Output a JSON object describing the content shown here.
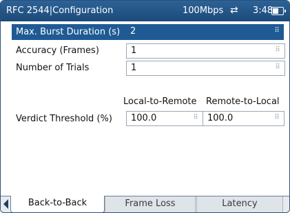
{
  "status_bar": {
    "title": "RFC 2544|Configuration",
    "speed": "100Mbps",
    "swap_icon": "link-swap-icon",
    "time": "3:48",
    "battery_icon": "battery-icon"
  },
  "fields": [
    {
      "label": "Max. Burst Duration (s)",
      "value": "2"
    },
    {
      "label": "Accuracy (Frames)",
      "value": "1"
    },
    {
      "label": "Number of Trials",
      "value": "1"
    }
  ],
  "verdict": {
    "col_local_to_remote": "Local-to-Remote",
    "col_remote_to_local": "Remote-to-Local",
    "label": "Verdict Threshold (%)",
    "local_to_remote": "100.0",
    "remote_to_local": "100.0"
  },
  "tabs": [
    {
      "label": "Back-to-Back",
      "active": true
    },
    {
      "label": "Frame Loss",
      "active": false
    },
    {
      "label": "Latency",
      "active": false
    }
  ],
  "colors": {
    "title_bar": "#1c4a7a",
    "selected_row": "#1f5a94"
  }
}
